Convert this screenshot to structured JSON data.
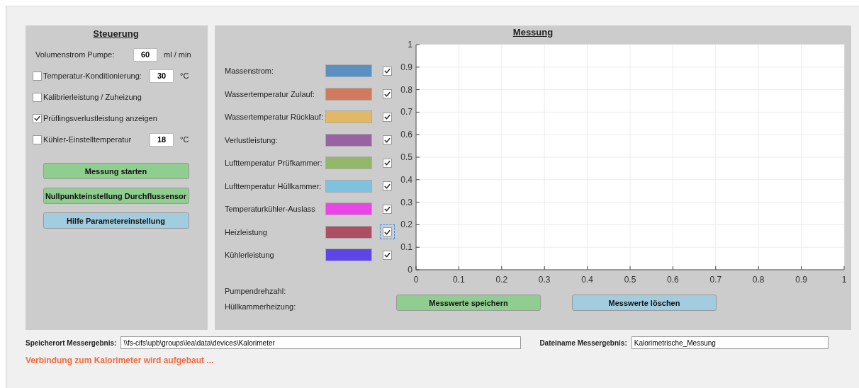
{
  "control": {
    "title": "Steuerung",
    "pump": {
      "label": "Volumenstrom Pumpe:",
      "value": "60",
      "unit": "ml / min"
    },
    "options": [
      {
        "label": "Temperatur-Konditionierung:",
        "checked": false,
        "value": "30",
        "unit": "°C"
      },
      {
        "label": "Kalibrierleistung / Zuheizung",
        "checked": false
      },
      {
        "label": "Prüflingsverlustleistung anzeigen",
        "checked": true
      },
      {
        "label": "Kühler-Einstelltemperatur",
        "checked": false,
        "value": "18",
        "unit": "°C"
      }
    ],
    "buttons": [
      {
        "label": "Messung starten",
        "color": "#90cd90"
      },
      {
        "label": "Nullpunkteinstellung Durchflussensor",
        "color": "#90cd90"
      },
      {
        "label": "Hilfe Parametereinstellung",
        "color": "#a2cde0"
      }
    ]
  },
  "measurement": {
    "title": "Messung",
    "legend": [
      {
        "label": "Massenstrom:",
        "color": "#5a90c2",
        "checked": true,
        "selected": false
      },
      {
        "label": "Wassertemperatur Zulauf:",
        "color": "#d27b5c",
        "checked": true,
        "selected": false
      },
      {
        "label": "Wassertemperatur Rücklauf:",
        "color": "#e0b866",
        "checked": true,
        "selected": false
      },
      {
        "label": "Verlustleistung:",
        "color": "#9963a3",
        "checked": true,
        "selected": false
      },
      {
        "label": "Lufttemperatur Prüfkammer:",
        "color": "#94b86a",
        "checked": true,
        "selected": false
      },
      {
        "label": "Lufttemperatur Hüllkammer:",
        "color": "#7fc2df",
        "checked": true,
        "selected": false
      },
      {
        "label": "Temperaturkühler-Auslass",
        "color": "#ea45e6",
        "checked": true,
        "selected": false
      },
      {
        "label": "Heizleistung",
        "color": "#ad4e63",
        "checked": true,
        "selected": true
      },
      {
        "label": "Kühlerleistung",
        "color": "#5e45e8",
        "checked": true,
        "selected": false
      }
    ],
    "chart_data": {
      "type": "line",
      "grid": true,
      "xlim": [
        0,
        1
      ],
      "ylim": [
        0,
        1
      ],
      "xticks": [
        {
          "value": 0,
          "label": "0"
        },
        {
          "value": 0.1,
          "label": "0.1"
        },
        {
          "value": 0.2,
          "label": "0.2"
        },
        {
          "value": 0.3,
          "label": "0.3"
        },
        {
          "value": 0.4,
          "label": "0.4"
        },
        {
          "value": 0.5,
          "label": "0.5"
        },
        {
          "value": 0.6,
          "label": "0.6"
        },
        {
          "value": 0.7,
          "label": "0.7"
        },
        {
          "value": 0.8,
          "label": "0.8"
        },
        {
          "value": 0.9,
          "label": "0.9"
        },
        {
          "value": 1,
          "label": "1"
        }
      ],
      "yticks": [
        {
          "value": 0,
          "label": "0"
        },
        {
          "value": 0.1,
          "label": "0.1"
        },
        {
          "value": 0.2,
          "label": "0.2"
        },
        {
          "value": 0.3,
          "label": "0.3"
        },
        {
          "value": 0.4,
          "label": "0.4"
        },
        {
          "value": 0.5,
          "label": "0.5"
        },
        {
          "value": 0.6,
          "label": "0.6"
        },
        {
          "value": 0.7,
          "label": "0.7"
        },
        {
          "value": 0.8,
          "label": "0.8"
        },
        {
          "value": 0.9,
          "label": "0.9"
        },
        {
          "value": 1,
          "label": "1"
        }
      ]
    },
    "info_labels": [
      "Pumpendrehzahl:",
      "Hüllkammerheizung:"
    ],
    "buttons": [
      {
        "label": "Messwerte speichern",
        "color": "#90cd90"
      },
      {
        "label": "Messwerte löschen",
        "color": "#a2cde0"
      }
    ]
  },
  "save": {
    "path_label": "Speicherort Messergebnis:",
    "path": "\\\\fs-cifs\\upb\\groups\\lea\\data\\devices\\Kalorimeter",
    "file_label": "Dateiname Messergebnis:",
    "file": "Kalorimetrische_Messung"
  },
  "status": "Verbindung zum Kalorimeter wird aufgebaut ..."
}
